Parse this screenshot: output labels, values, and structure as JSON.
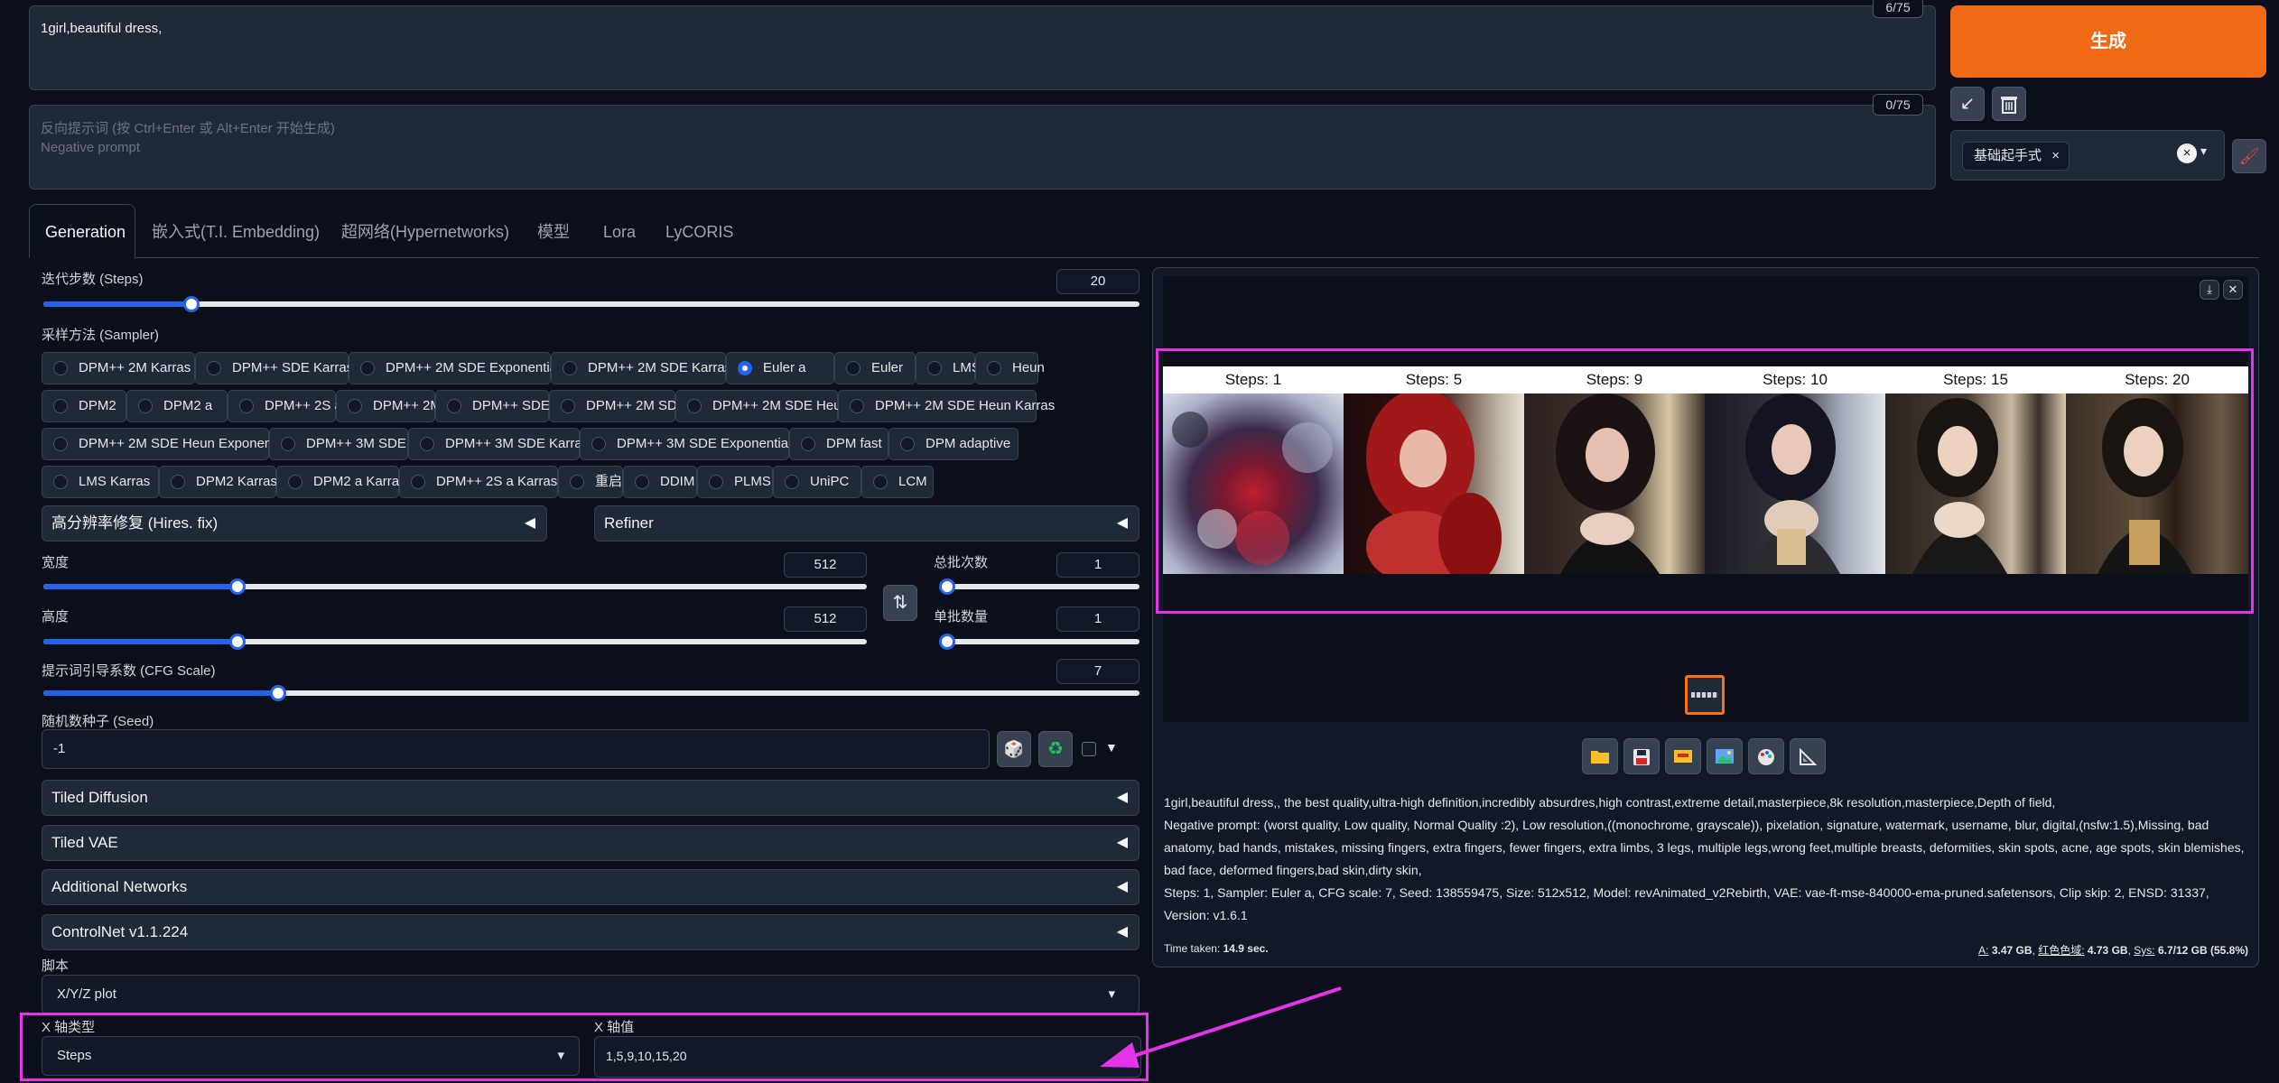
{
  "prompt": {
    "value": "1girl,beautiful dress,",
    "counter": "6/75"
  },
  "negative_prompt": {
    "placeholder_line1": "反向提示词 (按 Ctrl+Enter 或 Alt+Enter 开始生成)",
    "placeholder_line2": "Negative prompt",
    "counter": "0/75"
  },
  "generate": {
    "label": "生成",
    "color": "#f06a16"
  },
  "styles": {
    "selected_tag": "基础起手式",
    "tag_close": "×",
    "clear": "×",
    "dropdown": "▾"
  },
  "tabs": [
    {
      "label": "Generation",
      "active": true
    },
    {
      "label": "嵌入式(T.I. Embedding)"
    },
    {
      "label": "超网络(Hypernetworks)"
    },
    {
      "label": "模型"
    },
    {
      "label": "Lora"
    },
    {
      "label": "LyCORIS"
    }
  ],
  "steps": {
    "label": "迭代步数 (Steps)",
    "value": "20",
    "fraction": 0.13
  },
  "sampler": {
    "label": "采样方法 (Sampler)",
    "selected": "Euler a",
    "options": [
      "DPM++ 2M Karras",
      "DPM++ SDE Karras",
      "DPM++ 2M SDE Exponential",
      "DPM++ 2M SDE Karras",
      "Euler a",
      "Euler",
      "LMS",
      "Heun",
      "DPM2",
      "DPM2 a",
      "DPM++ 2S a",
      "DPM++ 2M",
      "DPM++ SDE",
      "DPM++ 2M SDE",
      "DPM++ 2M SDE Heun",
      "DPM++ 2M SDE Heun Karras",
      "DPM++ 2M SDE Heun Exponential",
      "DPM++ 3M SDE",
      "DPM++ 3M SDE Karras",
      "DPM++ 3M SDE Exponential",
      "DPM fast",
      "DPM adaptive",
      "LMS Karras",
      "DPM2 Karras",
      "DPM2 a Karras",
      "DPM++ 2S a Karras",
      "重启",
      "DDIM",
      "PLMS",
      "UniPC",
      "LCM"
    ]
  },
  "hires_fix": {
    "label": "高分辨率修复 (Hires. fix)",
    "arrow": "◀"
  },
  "refiner": {
    "label": "Refiner",
    "arrow": "◀"
  },
  "width": {
    "label": "宽度",
    "value": "512",
    "fraction": 0.23
  },
  "height": {
    "label": "高度",
    "value": "512",
    "fraction": 0.23
  },
  "swap_icon": "⇅",
  "batch_count": {
    "label": "总批次数",
    "value": "1",
    "fraction": 0.0
  },
  "batch_size": {
    "label": "单批数量",
    "value": "1",
    "fraction": 0.0
  },
  "cfg": {
    "label": "提示词引导系数 (CFG Scale)",
    "value": "7",
    "fraction": 0.21
  },
  "seed": {
    "label": "随机数种子 (Seed)",
    "value": "-1",
    "dice_icon": "🎲",
    "recycle_icon": "♻",
    "extra_arrow": "▼"
  },
  "accordions": [
    {
      "label": "Tiled Diffusion",
      "arrow": "◀"
    },
    {
      "label": "Tiled VAE",
      "arrow": "◀"
    },
    {
      "label": "Additional Networks",
      "arrow": "◀"
    },
    {
      "label": "ControlNet v1.1.224",
      "arrow": "◀"
    }
  ],
  "script": {
    "label": "脚本",
    "value": "X/Y/Z plot",
    "arrow": "▾"
  },
  "x_axis": {
    "type_label": "X 轴类型",
    "type_value": "Steps",
    "type_arrow": "▾",
    "values_label": "X 轴值",
    "values_value": "1,5,9,10,15,20"
  },
  "gallery": {
    "download_icon": "⤓",
    "close_icon": "✕",
    "columns": [
      "Steps: 1",
      "Steps: 5",
      "Steps: 9",
      "Steps: 10",
      "Steps: 15",
      "Steps: 20"
    ],
    "tool_icons": [
      "folder-icon",
      "save-icon",
      "zip-icon",
      "image-icon",
      "palette-icon",
      "ruler-icon"
    ]
  },
  "info": {
    "line1": "1girl,beautiful dress,, the best quality,ultra-high definition,incredibly absurdres,high contrast,extreme detail,masterpiece,8k resolution,masterpiece,Depth of field,",
    "line2": "Negative prompt: (worst quality, Low quality, Normal Quality :2), Low resolution,((monochrome, grayscale)), pixelation, signature, watermark, username, blur, digital,(nsfw:1.5),Missing, bad anatomy, bad hands, mistakes, missing fingers, extra fingers, fewer fingers, extra limbs, 3 legs, multiple legs,wrong feet,multiple breasts, deformities, skin spots, acne, age spots, skin blemishes, bad face, deformed fingers,bad skin,dirty skin,",
    "line3": "Steps: 1, Sampler: Euler a, CFG scale: 7, Seed: 138559475, Size: 512x512, Model: revAnimated_v2Rebirth, VAE: vae-ft-mse-840000-ema-pruned.safetensors, Clip skip: 2, ENSD: 31337, Version: v1.6.1",
    "time_label": "Time taken:",
    "time_value": "14.9 sec.",
    "mem_a_label": "A:",
    "mem_a": "3.47 GB",
    "mem_r_label": "红色色域:",
    "mem_r": "4.73 GB",
    "mem_sys_label": "Sys:",
    "mem_sys": "6.7/12 GB (55.8%)"
  }
}
